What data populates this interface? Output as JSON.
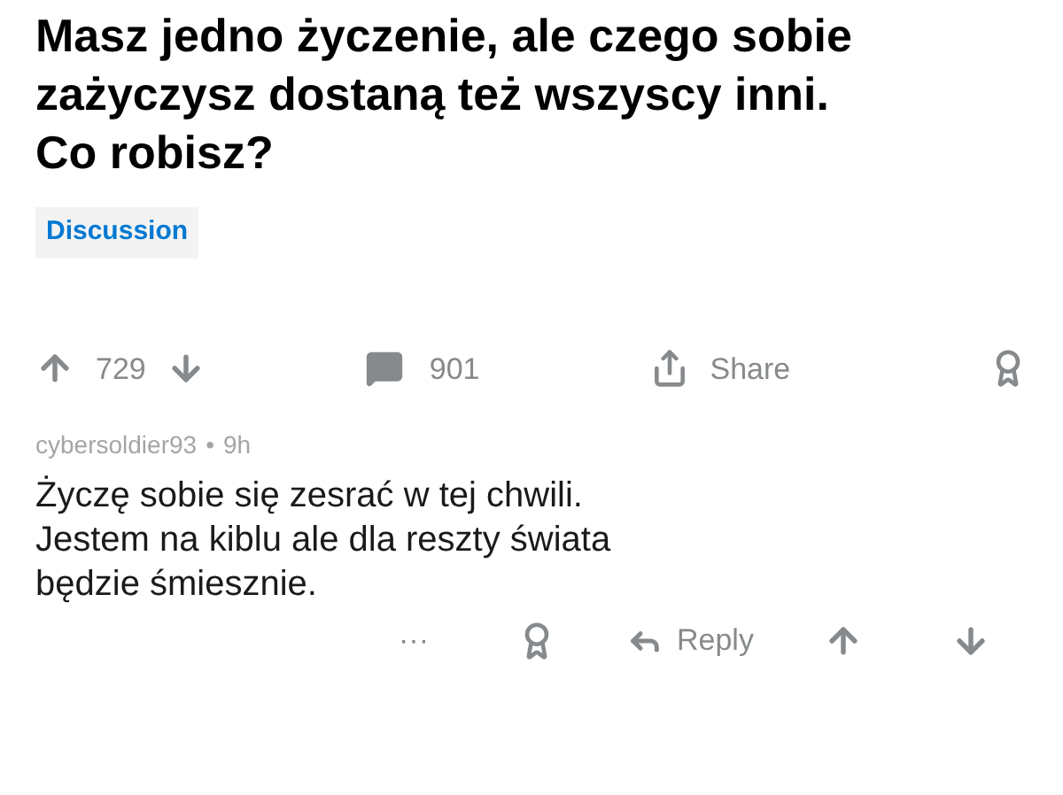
{
  "post": {
    "title": "Masz jedno życzenie, ale czego sobie zażyczysz dostaną też wszyscy inni. Co robisz?",
    "flair": "Discussion",
    "votes": "729",
    "comments": "901",
    "share": "Share"
  },
  "comment": {
    "author": "cybersoldier93",
    "separator": "•",
    "age": "9h",
    "body": "Życzę sobie się zesrać w tej chwili. Jestem na kiblu ale dla reszty świata będzie śmiesznie.",
    "more": "···",
    "reply": "Reply"
  }
}
